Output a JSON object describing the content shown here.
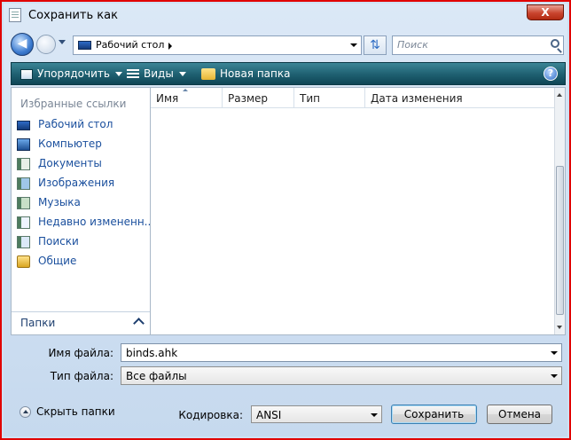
{
  "title": "Сохранить как",
  "address": {
    "path": "Рабочий стол"
  },
  "search": {
    "placeholder": "Поиск"
  },
  "toolbar": {
    "organize": "Упорядочить",
    "views": "Виды",
    "new_folder": "Новая папка"
  },
  "sidebar": {
    "header": "Избранные ссылки",
    "items": [
      {
        "label": "Рабочий стол",
        "icon": "desktop-icon"
      },
      {
        "label": "Компьютер",
        "icon": "computer-icon"
      },
      {
        "label": "Документы",
        "icon": "documents-icon"
      },
      {
        "label": "Изображения",
        "icon": "pictures-icon"
      },
      {
        "label": "Музыка",
        "icon": "music-icon"
      },
      {
        "label": "Недавно измененн...",
        "icon": "recent-icon"
      },
      {
        "label": "Поиски",
        "icon": "searches-icon"
      },
      {
        "label": "Общие",
        "icon": "public-folder-icon"
      }
    ],
    "folders_label": "Папки"
  },
  "columns": [
    "Имя",
    "Размер",
    "Тип",
    "Дата изменения"
  ],
  "form": {
    "filename_label": "Имя файла:",
    "filename_value": "binds.ahk",
    "filetype_label": "Тип файла:",
    "filetype_value": "Все файлы",
    "encoding_label": "Кодировка:",
    "encoding_value": "ANSI"
  },
  "buttons": {
    "hide_folders": "Скрыть папки",
    "save": "Сохранить",
    "cancel": "Отмена",
    "close": "X"
  },
  "colors": {
    "accent_border": "#e10000",
    "command_bar": "#1e5f70",
    "link": "#1a4f9d"
  }
}
